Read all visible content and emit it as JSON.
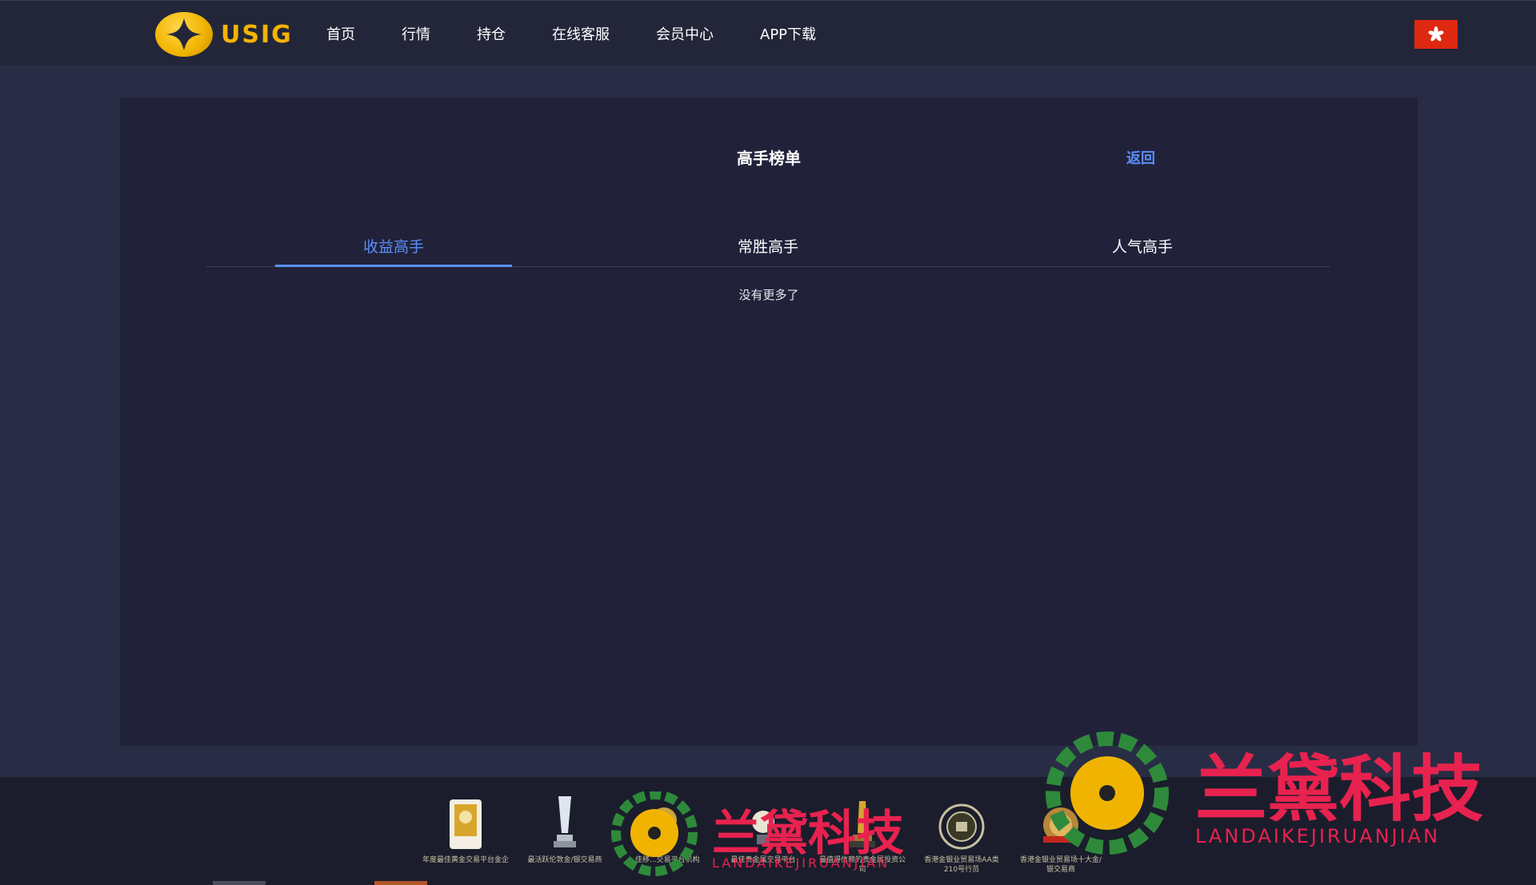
{
  "header": {
    "logo_text": "USIG",
    "nav": [
      "首页",
      "行情",
      "持仓",
      "在线客服",
      "会员中心",
      "APP下载"
    ],
    "language_flag": "hong-kong-flag-icon"
  },
  "page": {
    "title": "高手榜单",
    "back_label": "返回",
    "tabs": [
      {
        "label": "收益高手",
        "active": true
      },
      {
        "label": "常胜高手",
        "active": false
      },
      {
        "label": "人气高手",
        "active": false
      }
    ],
    "empty_text": "没有更多了"
  },
  "footer": {
    "awards": [
      {
        "caption": "年度最佳黄金交易平台金企",
        "icon": "certificate-icon"
      },
      {
        "caption": "最活跃伦敦金/银交易商",
        "icon": "crystal-trophy-icon"
      },
      {
        "caption": "...佳移...交易平台机构",
        "icon": "award-icon"
      },
      {
        "caption": "最佳贵金属交易平台",
        "icon": "award-icon"
      },
      {
        "caption": "最值得信赖的贵金属投资公司",
        "icon": "gold-trophy-icon"
      },
      {
        "caption": "香港金银业贸易场AA类210号行员",
        "icon": "seal-icon"
      },
      {
        "caption": "香港金银业贸易场十大金/银交易商",
        "icon": "medal-icon"
      }
    ]
  },
  "watermark": {
    "large_title": "兰黛科技",
    "large_sub": "LANDAIKEJIRUANJIAN",
    "small_title": "兰黛科技",
    "small_sub": "LANDAIKEJIRUANJIAN"
  },
  "colors": {
    "accent": "#5b8ff9",
    "brand_gold": "#f4b400",
    "watermark_red": "#e8224f",
    "flag_red": "#de2910"
  }
}
